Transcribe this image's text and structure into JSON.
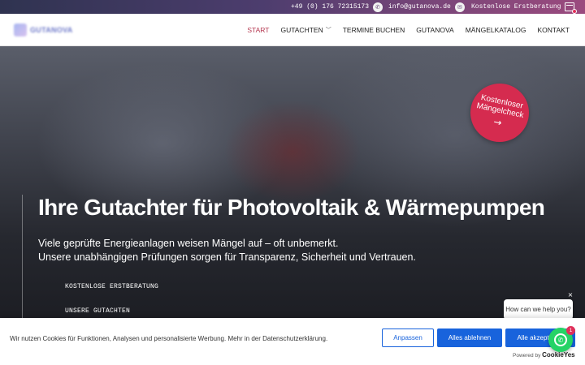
{
  "topbar": {
    "phone": "+49 (0) 176 72315173",
    "phone_icon": "phone-icon",
    "email": "info@gutanova.de",
    "email_icon": "mail-icon",
    "consult": "Kostenlose Erstberatung",
    "consult_icon": "calendar-icon"
  },
  "nav": {
    "logo_text": "GUTANOVA",
    "items": [
      {
        "label": "START",
        "active": true
      },
      {
        "label": "GUTACHTEN",
        "dropdown": true
      },
      {
        "label": "TERMINE BUCHEN"
      },
      {
        "label": "GUTANOVA"
      },
      {
        "label": "MÄNGELKATALOG"
      },
      {
        "label": "KONTAKT"
      }
    ]
  },
  "hero": {
    "title": "Ihre Gutachter für Photovoltaik &  Wärmepumpen",
    "subtitle_line1": "Viele geprüfte Energieanlagen weisen Mängel auf – oft unbemerkt.",
    "subtitle_line2": "Unsere unabhängigen Prüfungen sorgen für Transparenz, Sicherheit und Vertrauen.",
    "link1": "KOSTENLOSE ERSTBERATUNG",
    "link2": "UNSERE GUTACHTEN",
    "badge_text": "Kostenloser Mängelcheck",
    "badge_arrow": "→"
  },
  "chat": {
    "bubble": "How can we help you?",
    "close": "×",
    "count": "1"
  },
  "cookie": {
    "text": "Wir nutzen Cookies für Funktionen, Analysen und personalisierte Werbung. Mehr in der Datenschutzerklärung.",
    "customize": "Anpassen",
    "reject": "Alles ablehnen",
    "accept": "Alle akzeptieren",
    "powered_by": "Powered by",
    "brand": "CookieYes"
  },
  "colors": {
    "accent": "#d52b4f",
    "primary_button": "#1863dc",
    "whatsapp": "#25d366"
  }
}
